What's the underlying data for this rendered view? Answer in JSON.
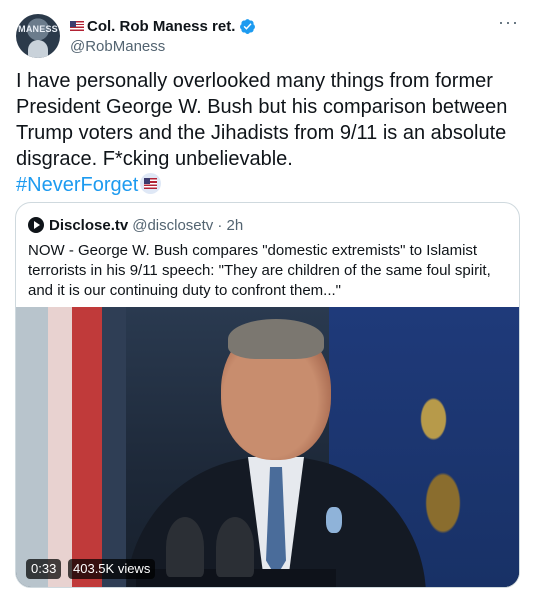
{
  "author": {
    "display_name": "Col. Rob Maness ret.",
    "handle": "@RobManess",
    "avatar_text": "MANESS",
    "verified": true
  },
  "tweet": {
    "text": "I have personally overlooked many things from former President George W. Bush but his comparison between Trump voters and the Jihadists from 9/11 is an absolute disgrace. F*cking unbelievable.",
    "hashtag": "#NeverForget"
  },
  "more_label": "···",
  "quoted": {
    "name": "Disclose.tv",
    "handle": "@disclosetv",
    "time": "· 2h",
    "text": "NOW - George W. Bush compares \"domestic extremists\" to Islamist terrorists in his 9/11 speech: \"They are children of the same foul spirit, and it is our continuing duty to confront them...\"",
    "video": {
      "duration": "0:33",
      "views": "403.5K views"
    }
  },
  "colors": {
    "link": "#1d9bf0",
    "secondary_text": "#536471",
    "border": "#cfd9de"
  }
}
